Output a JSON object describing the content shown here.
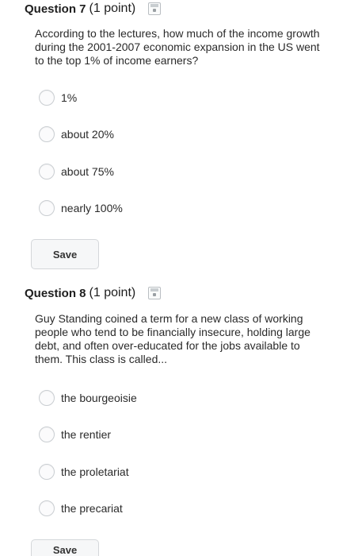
{
  "q7": {
    "title": "Question 7",
    "points": "(1 point)",
    "text": "According to the lectures, how much of the income growth during the 2001-2007 economic expansion in the US went to the top 1% of income earners?",
    "options": [
      "1%",
      "about 20%",
      "about 75%",
      "nearly 100%"
    ],
    "save_label": "Save"
  },
  "q8": {
    "title": "Question 8",
    "points": "(1 point)",
    "text": "Guy Standing coined a term for a new class of working people who tend to be financially insecure, holding large debt, and often over-educated for the jobs available to them.  This class is called...",
    "options": [
      "the bourgeoisie",
      "the rentier",
      "the proletariat",
      "the precariat"
    ],
    "save_label": "Save"
  }
}
